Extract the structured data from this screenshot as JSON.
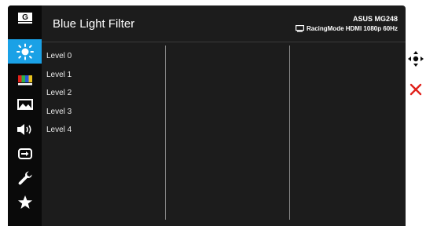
{
  "header": {
    "title": "Blue Light Filter",
    "model": "ASUS MG248",
    "mode_line": "RacingMode HDMI 1080p 60Hz"
  },
  "levels": [
    "Level 0",
    "Level 1",
    "Level 2",
    "Level 3",
    "Level 4"
  ],
  "sidebar": {
    "items": [
      {
        "name": "gameplus",
        "icon": "gameplus-icon",
        "glyph": "G"
      },
      {
        "name": "blue-light-filter",
        "icon": "sun-icon",
        "active": true
      },
      {
        "name": "color",
        "icon": "color-bars-icon"
      },
      {
        "name": "image",
        "icon": "image-icon"
      },
      {
        "name": "sound",
        "icon": "speaker-icon"
      },
      {
        "name": "input-select",
        "icon": "input-icon"
      },
      {
        "name": "system-setup",
        "icon": "wrench-icon"
      },
      {
        "name": "shortcut",
        "icon": "star-icon"
      }
    ]
  },
  "navigation": {
    "move_icon": "move-icon",
    "exit_icon": "close-icon"
  },
  "colors": {
    "accent": "#1aa1e6",
    "panel": "#1c1c1c",
    "sidebar": "#0a0a0a",
    "exit_red": "#e0211b"
  }
}
